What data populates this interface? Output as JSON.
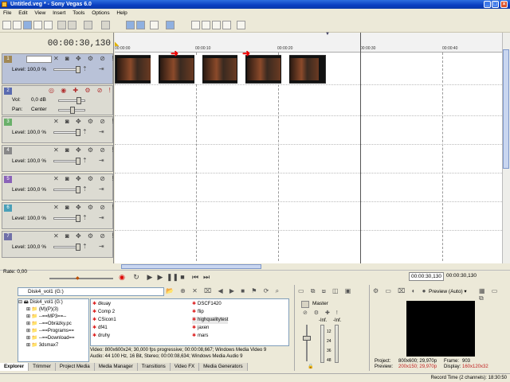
{
  "window": {
    "title": "Untitled.veg * - Sony Vegas 6.0",
    "controls": [
      "_",
      "□",
      "×"
    ]
  },
  "menu": [
    "File",
    "Edit",
    "View",
    "Insert",
    "Tools",
    "Options",
    "Help"
  ],
  "toolbar": {
    "icons": [
      "new-icon",
      "open-icon",
      "save-icon",
      "properties-icon",
      "render-icon",
      "undo-icon",
      "redo-icon",
      "cut-icon",
      "copy-icon",
      "paste-icon",
      "enable-snapping-icon",
      "auto-ripple-icon",
      "lock-envelopes-icon",
      "normal-edit-tool-icon",
      "envelope-edit-tool-icon",
      "selection-edit-tool-icon",
      "zoom-edit-tool-icon",
      "whats-this-icon"
    ]
  },
  "timecode": "00:00:30,130",
  "ruler": {
    "ticks": [
      "00:00:00",
      "00:00:10",
      "00:00:20",
      "00:00:30",
      "00:00:40"
    ]
  },
  "tracks": [
    {
      "num": "1",
      "type": "video",
      "level": "Level: 100,0 %"
    },
    {
      "num": "2",
      "type": "audio",
      "vol": "Vol:",
      "vol_val": "0,0 dB",
      "pan": "Pan:",
      "pan_val": "Center"
    },
    {
      "num": "3",
      "type": "video",
      "level": "Level: 100,0 %"
    },
    {
      "num": "4",
      "type": "video",
      "level": "Level: 100,0 %"
    },
    {
      "num": "5",
      "type": "video",
      "level": "Level: 100,0 %"
    },
    {
      "num": "6",
      "type": "video",
      "level": "Level: 100,0 %"
    },
    {
      "num": "7",
      "type": "video",
      "level": "Level: 100,0 %"
    }
  ],
  "track_colors": [
    "#a08855",
    "#5a6bb0",
    "#6ab06a",
    "#888888",
    "#8a62b8",
    "#4aa0b8",
    "#7070a8"
  ],
  "transport": {
    "rate": "Rate: 0,00",
    "timecode": "00:00:30,130",
    "timecode2": "00:00:30,130"
  },
  "explorer": {
    "drive": "Disk4_vol1 (G:)",
    "tree": [
      "Disk4_vol1 (G:)",
      "(M)(P)(3)",
      "--==MP3==--",
      "--==Obrázky.pc",
      "--==Programs==",
      "--==Download==",
      "3dsmax7"
    ],
    "files_col1": [
      "dkuay",
      "Comp 2",
      "CSicon1",
      "df41",
      "druhy"
    ],
    "files_col2": [
      "DSCF1420",
      "flip",
      "highqualitytest",
      "jaxen",
      "mars"
    ],
    "info_line1": "Video: 800x600x24; 30,000 fps progressive; 00:00:08,667; Windows Media Video 9",
    "info_line2": "Audio: 44 100 Hz, 16 Bit, Stereo; 00:00:08,634; Windows Media Audio 9",
    "tabs": [
      "Explorer",
      "Trimmer",
      "Project Media",
      "Media Manager",
      "Transitions",
      "Video FX",
      "Media Generators"
    ]
  },
  "mixer": {
    "label": "Master",
    "db_top": "-Inf.",
    "db_top2": "-Inf.",
    "scale": [
      "12",
      "24",
      "36",
      "48"
    ],
    "fader": "0,0"
  },
  "preview": {
    "dropdown": "Preview (Auto)",
    "project_label": "Project:",
    "project": "800x600; 29,970p",
    "frame_label": "Frame:",
    "frame": "903",
    "preview_label": "Preview:",
    "preview_val": "200x150; 29,970p",
    "display_label": "Display:",
    "display": "160x120x32"
  },
  "status": "Record Time (2 channels): 18:30:50"
}
